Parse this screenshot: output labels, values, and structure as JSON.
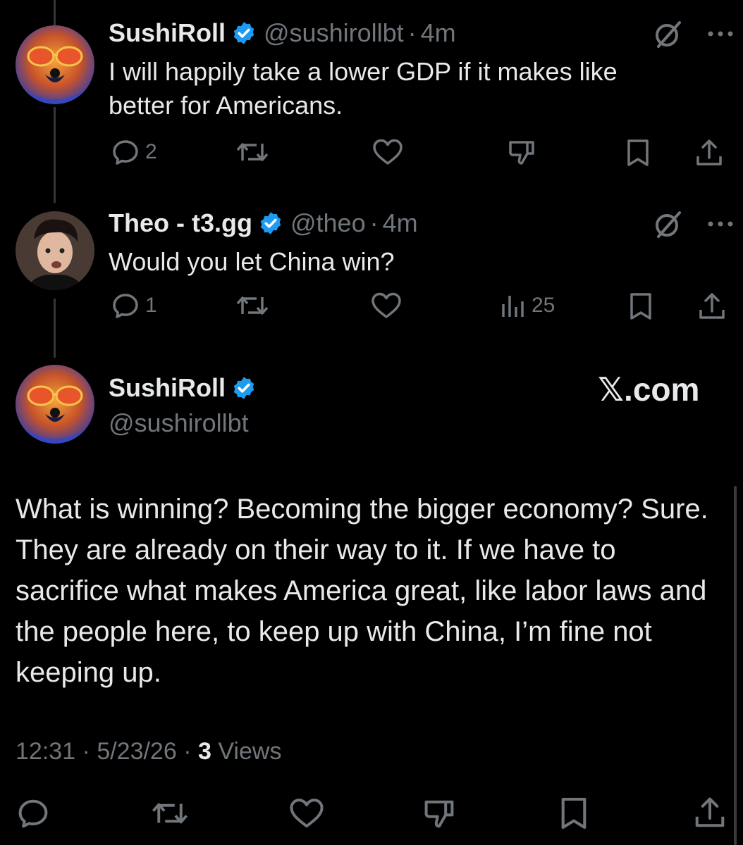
{
  "colors": {
    "background": "#000000",
    "text": "#e7e9ea",
    "muted": "#71767b",
    "verified_blue": "#1d9bf0",
    "thread_line": "#333639"
  },
  "tweets": [
    {
      "name": "SushiRoll",
      "handle": "@sushirollbt",
      "time": "4m",
      "text": "I will happily take a lower GDP if it makes like better for Americans.",
      "replies": "2",
      "views": ""
    },
    {
      "name": "Theo - t3.gg",
      "handle": "@theo",
      "time": "4m",
      "text": "Would you let China win?",
      "replies": "1",
      "views": "25"
    }
  ],
  "main_tweet": {
    "name": "SushiRoll",
    "handle": "@sushirollbt",
    "watermark": "𝕏.com",
    "text": "What is winning? Becoming the bigger economy? Sure. They are already on their way to it. If we have to sacrifice what makes America great, like labor laws and the people here, to keep up with China, I’m fine not keeping up.",
    "time": "12:31",
    "date": "5/23/26",
    "views_count": "3",
    "views_label": "Views"
  },
  "icons": {
    "reply": "reply-icon",
    "repost": "repost-icon",
    "like": "heart-icon",
    "dislike": "thumbs-down-icon",
    "views": "views-chart-icon",
    "bookmark": "bookmark-icon",
    "share": "share-icon",
    "grok": "grok-icon",
    "more": "more-icon",
    "verified": "verified-badge-icon"
  }
}
